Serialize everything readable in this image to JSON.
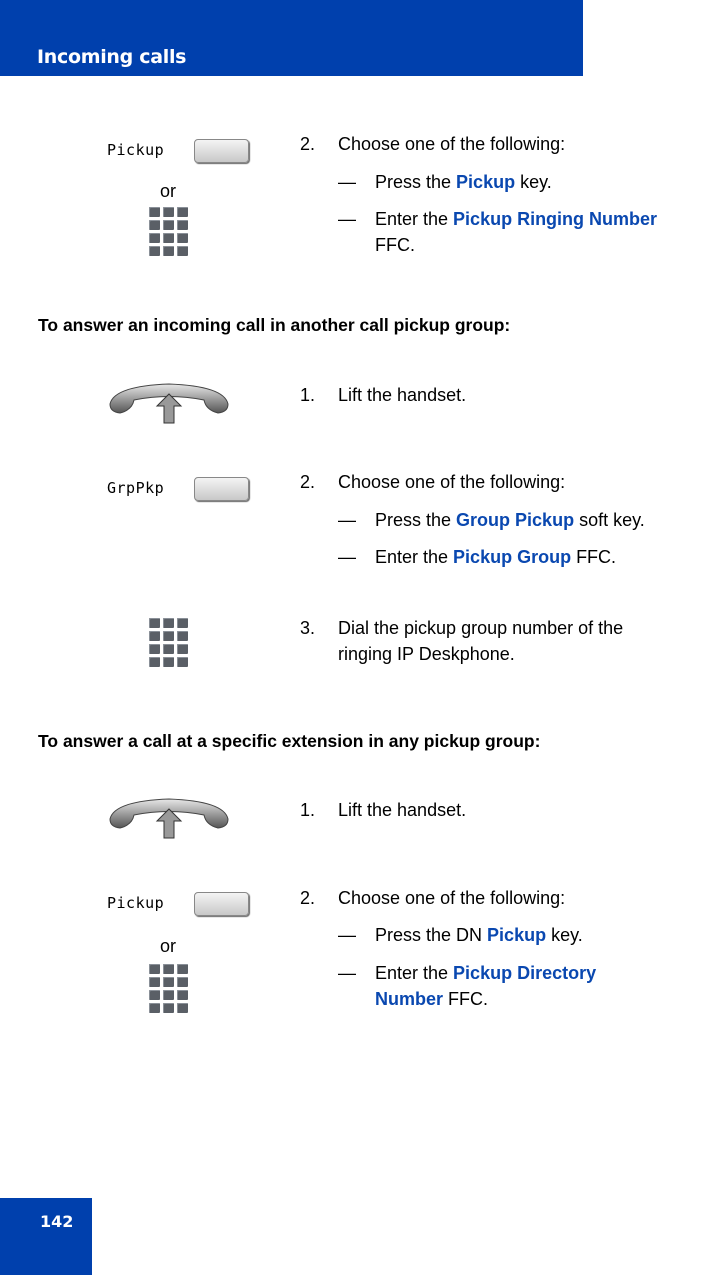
{
  "header": {
    "title": "Incoming calls"
  },
  "footer": {
    "page_number": "142"
  },
  "section1": {
    "softkey_label": "Pickup",
    "or_label": "or",
    "step_number": "2.",
    "step_text": "Choose one of the following:",
    "options": [
      {
        "dash": "—",
        "before": "Press the ",
        "highlight": "Pickup",
        "after": " key."
      },
      {
        "dash": "—",
        "before": "Enter the ",
        "highlight": "Pickup Ringing Number",
        "after": " FFC."
      }
    ]
  },
  "section2": {
    "heading": "To answer an incoming call in another call pickup group:",
    "step1": {
      "number": "1.",
      "text": "Lift the handset."
    },
    "step2": {
      "softkey_label": "GrpPkp",
      "number": "2.",
      "text": "Choose one of the following:",
      "options": [
        {
          "dash": "—",
          "before": "Press the ",
          "highlight": "Group Pickup",
          "after": " soft key."
        },
        {
          "dash": "—",
          "before": "Enter the ",
          "highlight": "Pickup Group",
          "after": " FFC."
        }
      ]
    },
    "step3": {
      "number": "3.",
      "text": "Dial the pickup group number of the ringing IP Deskphone."
    }
  },
  "section3": {
    "heading": "To answer a call at a specific extension in any pickup group:",
    "step1": {
      "number": "1.",
      "text": "Lift the handset."
    },
    "step2": {
      "softkey_label": "Pickup",
      "or_label": "or",
      "number": "2.",
      "text": "Choose one of the following:",
      "options": [
        {
          "dash": "—",
          "before": "Press the DN ",
          "highlight": "Pickup",
          "after": " key."
        },
        {
          "dash": "—",
          "before": "Enter the ",
          "highlight": "Pickup Directory Number",
          "after": " FFC."
        }
      ]
    }
  }
}
